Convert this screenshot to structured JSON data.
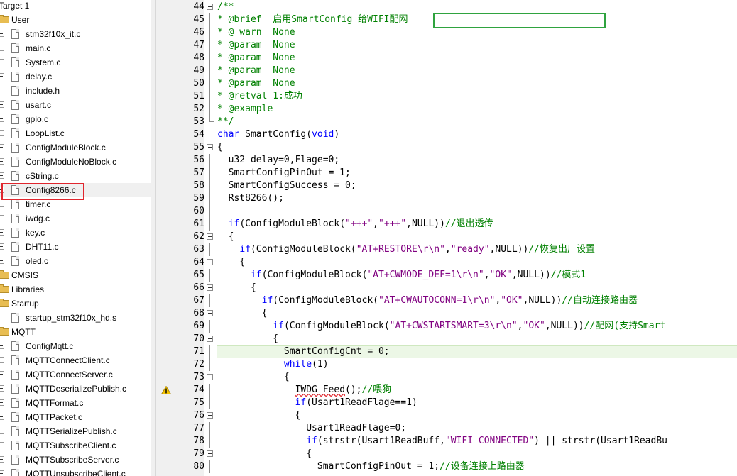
{
  "colors": {
    "selection_box": "#e0262e",
    "brief_box": "#2fa33f",
    "comment": "#008000",
    "keyword": "#0000ff",
    "string": "#800080",
    "current_line": "#ecf7e6",
    "folder": "#e8bd52"
  },
  "project_tree": {
    "rows": [
      {
        "label": "Target 1",
        "type": "target",
        "depth": 0
      },
      {
        "label": "User",
        "type": "folder",
        "depth": 1,
        "expanded": true
      },
      {
        "label": "stm32f10x_it.c",
        "type": "file",
        "depth": 2,
        "expander": true
      },
      {
        "label": "main.c",
        "type": "file",
        "depth": 2,
        "expander": true
      },
      {
        "label": "System.c",
        "type": "file",
        "depth": 2,
        "expander": true
      },
      {
        "label": "delay.c",
        "type": "file",
        "depth": 2,
        "expander": true
      },
      {
        "label": "include.h",
        "type": "file",
        "depth": 2,
        "expander": false
      },
      {
        "label": "usart.c",
        "type": "file",
        "depth": 2,
        "expander": true
      },
      {
        "label": "gpio.c",
        "type": "file",
        "depth": 2,
        "expander": true
      },
      {
        "label": "LoopList.c",
        "type": "file",
        "depth": 2,
        "expander": true
      },
      {
        "label": "ConfigModuleBlock.c",
        "type": "file",
        "depth": 2,
        "expander": true
      },
      {
        "label": "ConfigModuleNoBlock.c",
        "type": "file",
        "depth": 2,
        "expander": true
      },
      {
        "label": "cString.c",
        "type": "file",
        "depth": 2,
        "expander": true
      },
      {
        "label": "Config8266.c",
        "type": "file",
        "depth": 2,
        "expander": true,
        "selected": true
      },
      {
        "label": "timer.c",
        "type": "file",
        "depth": 2,
        "expander": true
      },
      {
        "label": "iwdg.c",
        "type": "file",
        "depth": 2,
        "expander": true
      },
      {
        "label": "key.c",
        "type": "file",
        "depth": 2,
        "expander": true
      },
      {
        "label": "DHT11.c",
        "type": "file",
        "depth": 2,
        "expander": true
      },
      {
        "label": "oled.c",
        "type": "file",
        "depth": 2,
        "expander": true
      },
      {
        "label": "CMSIS",
        "type": "folder",
        "depth": 1,
        "expanded": false
      },
      {
        "label": "Libraries",
        "type": "folder",
        "depth": 1,
        "expanded": false
      },
      {
        "label": "Startup",
        "type": "folder",
        "depth": 1,
        "expanded": true
      },
      {
        "label": "startup_stm32f10x_hd.s",
        "type": "file",
        "depth": 2,
        "expander": false
      },
      {
        "label": "MQTT",
        "type": "folder",
        "depth": 1,
        "expanded": true
      },
      {
        "label": "ConfigMqtt.c",
        "type": "file",
        "depth": 2,
        "expander": true
      },
      {
        "label": "MQTTConnectClient.c",
        "type": "file",
        "depth": 2,
        "expander": true
      },
      {
        "label": "MQTTConnectServer.c",
        "type": "file",
        "depth": 2,
        "expander": true
      },
      {
        "label": "MQTTDeserializePublish.c",
        "type": "file",
        "depth": 2,
        "expander": true
      },
      {
        "label": "MQTTFormat.c",
        "type": "file",
        "depth": 2,
        "expander": true
      },
      {
        "label": "MQTTPacket.c",
        "type": "file",
        "depth": 2,
        "expander": true
      },
      {
        "label": "MQTTSerializePublish.c",
        "type": "file",
        "depth": 2,
        "expander": true
      },
      {
        "label": "MQTTSubscribeClient.c",
        "type": "file",
        "depth": 2,
        "expander": true
      },
      {
        "label": "MQTTSubscribeServer.c",
        "type": "file",
        "depth": 2,
        "expander": true
      },
      {
        "label": "MQTTUnsubscribeClient.c",
        "type": "file",
        "depth": 2,
        "expander": true
      }
    ]
  },
  "editor": {
    "current_line": 71,
    "warning_line": 74,
    "lines": [
      {
        "n": "44",
        "fold": "box",
        "tokens": [
          [
            "cm",
            "/**"
          ]
        ]
      },
      {
        "n": "45",
        "fold": "line",
        "tokens": [
          [
            "cm",
            "* @brief  启用SmartConfig 给WIFI配网"
          ]
        ]
      },
      {
        "n": "46",
        "fold": "line",
        "tokens": [
          [
            "cm",
            "* @ warn  None"
          ]
        ]
      },
      {
        "n": "47",
        "fold": "line",
        "tokens": [
          [
            "cm",
            "* @param  None"
          ]
        ]
      },
      {
        "n": "48",
        "fold": "line",
        "tokens": [
          [
            "cm",
            "* @param  None"
          ]
        ]
      },
      {
        "n": "49",
        "fold": "line",
        "tokens": [
          [
            "cm",
            "* @param  None"
          ]
        ]
      },
      {
        "n": "50",
        "fold": "line",
        "tokens": [
          [
            "cm",
            "* @param  None"
          ]
        ]
      },
      {
        "n": "51",
        "fold": "line",
        "tokens": [
          [
            "cm",
            "* @retval 1:成功"
          ]
        ]
      },
      {
        "n": "52",
        "fold": "line",
        "tokens": [
          [
            "cm",
            "* @example"
          ]
        ]
      },
      {
        "n": "53",
        "fold": "end",
        "tokens": [
          [
            "cm",
            "**/"
          ]
        ]
      },
      {
        "n": "54",
        "fold": "",
        "tokens": [
          [
            "kw",
            "char"
          ],
          [
            "pl",
            " SmartConfig("
          ],
          [
            "kw",
            "void"
          ],
          [
            "pl",
            ")"
          ]
        ]
      },
      {
        "n": "55",
        "fold": "box",
        "tokens": [
          [
            "pl",
            "{"
          ]
        ]
      },
      {
        "n": "56",
        "fold": "line",
        "tokens": [
          [
            "pl",
            "  u32 delay=0,Flage=0;"
          ]
        ]
      },
      {
        "n": "57",
        "fold": "line",
        "tokens": [
          [
            "pl",
            "  SmartConfigPinOut = 1;"
          ]
        ]
      },
      {
        "n": "58",
        "fold": "line",
        "tokens": [
          [
            "pl",
            "  SmartConfigSuccess = 0;"
          ]
        ]
      },
      {
        "n": "59",
        "fold": "line",
        "tokens": [
          [
            "pl",
            "  Rst8266();"
          ]
        ]
      },
      {
        "n": "60",
        "fold": "line",
        "tokens": []
      },
      {
        "n": "61",
        "fold": "line",
        "tokens": [
          [
            "pl",
            "  "
          ],
          [
            "kw",
            "if"
          ],
          [
            "pl",
            "(ConfigModuleBlock("
          ],
          [
            "str",
            "\"+++\""
          ],
          [
            "pl",
            ","
          ],
          [
            "str",
            "\"+++\""
          ],
          [
            "pl",
            ",NULL))"
          ],
          [
            "cm",
            "//退出透传"
          ]
        ]
      },
      {
        "n": "62",
        "fold": "box",
        "tokens": [
          [
            "pl",
            "  {"
          ]
        ]
      },
      {
        "n": "63",
        "fold": "line",
        "tokens": [
          [
            "pl",
            "    "
          ],
          [
            "kw",
            "if"
          ],
          [
            "pl",
            "(ConfigModuleBlock("
          ],
          [
            "str",
            "\"AT+RESTORE\\r\\n\""
          ],
          [
            "pl",
            ","
          ],
          [
            "str",
            "\"ready\""
          ],
          [
            "pl",
            ",NULL))"
          ],
          [
            "cm",
            "//恢复出厂设置"
          ]
        ]
      },
      {
        "n": "64",
        "fold": "box",
        "tokens": [
          [
            "pl",
            "    {"
          ]
        ]
      },
      {
        "n": "65",
        "fold": "line",
        "tokens": [
          [
            "pl",
            "      "
          ],
          [
            "kw",
            "if"
          ],
          [
            "pl",
            "(ConfigModuleBlock("
          ],
          [
            "str",
            "\"AT+CWMODE_DEF=1\\r\\n\""
          ],
          [
            "pl",
            ","
          ],
          [
            "str",
            "\"OK\""
          ],
          [
            "pl",
            ",NULL))"
          ],
          [
            "cm",
            "//模式1"
          ]
        ]
      },
      {
        "n": "66",
        "fold": "box",
        "tokens": [
          [
            "pl",
            "      {"
          ]
        ]
      },
      {
        "n": "67",
        "fold": "line",
        "tokens": [
          [
            "pl",
            "        "
          ],
          [
            "kw",
            "if"
          ],
          [
            "pl",
            "(ConfigModuleBlock("
          ],
          [
            "str",
            "\"AT+CWAUTOCONN=1\\r\\n\""
          ],
          [
            "pl",
            ","
          ],
          [
            "str",
            "\"OK\""
          ],
          [
            "pl",
            ",NULL))"
          ],
          [
            "cm",
            "//自动连接路由器"
          ]
        ]
      },
      {
        "n": "68",
        "fold": "box",
        "tokens": [
          [
            "pl",
            "        {"
          ]
        ]
      },
      {
        "n": "69",
        "fold": "line",
        "tokens": [
          [
            "pl",
            "          "
          ],
          [
            "kw",
            "if"
          ],
          [
            "pl",
            "(ConfigModuleBlock("
          ],
          [
            "str",
            "\"AT+CWSTARTSMART=3\\r\\n\""
          ],
          [
            "pl",
            ","
          ],
          [
            "str",
            "\"OK\""
          ],
          [
            "pl",
            ",NULL))"
          ],
          [
            "cm",
            "//配网(支持Smart"
          ]
        ]
      },
      {
        "n": "70",
        "fold": "box",
        "tokens": [
          [
            "pl",
            "          {"
          ]
        ]
      },
      {
        "n": "71",
        "fold": "line",
        "tokens": [
          [
            "pl",
            "            SmartConfigCnt = 0;"
          ]
        ]
      },
      {
        "n": "72",
        "fold": "line",
        "tokens": [
          [
            "pl",
            "            "
          ],
          [
            "kw",
            "while"
          ],
          [
            "pl",
            "(1)"
          ]
        ]
      },
      {
        "n": "73",
        "fold": "box",
        "tokens": [
          [
            "pl",
            "            {"
          ]
        ]
      },
      {
        "n": "74",
        "fold": "line",
        "tokens": [
          [
            "pl",
            "              "
          ],
          [
            "sq",
            "IWDG_Feed"
          ],
          [
            "pl",
            "();"
          ],
          [
            "cm",
            "//喂狗"
          ]
        ]
      },
      {
        "n": "75",
        "fold": "line",
        "tokens": [
          [
            "pl",
            "              "
          ],
          [
            "kw",
            "if"
          ],
          [
            "pl",
            "(Usart1ReadFlage==1)"
          ]
        ]
      },
      {
        "n": "76",
        "fold": "box",
        "tokens": [
          [
            "pl",
            "              {"
          ]
        ]
      },
      {
        "n": "77",
        "fold": "line",
        "tokens": [
          [
            "pl",
            "                Usart1ReadFlage=0;"
          ]
        ]
      },
      {
        "n": "78",
        "fold": "line",
        "tokens": [
          [
            "pl",
            "                "
          ],
          [
            "kw",
            "if"
          ],
          [
            "pl",
            "(strstr(Usart1ReadBuff,"
          ],
          [
            "str",
            "\"WIFI CONNECTED\""
          ],
          [
            "pl",
            ") || strstr(Usart1ReadBu"
          ]
        ]
      },
      {
        "n": "79",
        "fold": "box",
        "tokens": [
          [
            "pl",
            "                {"
          ]
        ]
      },
      {
        "n": "80",
        "fold": "line",
        "tokens": [
          [
            "pl",
            "                  SmartConfigPinOut = 1;"
          ],
          [
            "cm",
            "//设备连接上路由器"
          ]
        ]
      }
    ]
  }
}
